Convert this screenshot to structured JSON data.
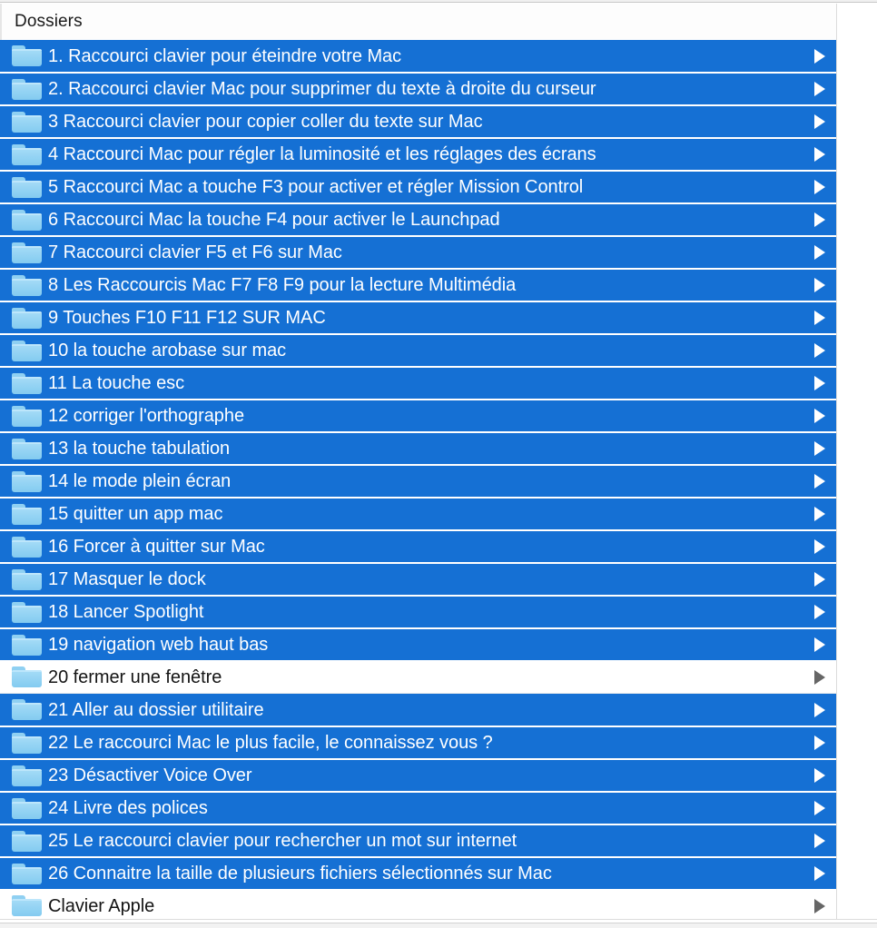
{
  "window": {
    "title": "Dossiers"
  },
  "header": {
    "column_title": "Dossiers"
  },
  "colors": {
    "selection_blue": "#1570d4",
    "folder_icon_blue": "#8ed2f4",
    "selected_text": "#ffffff",
    "unselected_text": "#141414",
    "disclosure_selected": "#ffffff",
    "disclosure_unselected": "#666666",
    "row_background": "#ffffff",
    "divider": "#dcdcdc"
  },
  "icons": {
    "folder": "folder-icon",
    "disclosure": "disclosure-triangle-icon"
  },
  "list": {
    "rows": [
      {
        "label": "1. Raccourci clavier pour éteindre votre Mac",
        "selected": true,
        "icon": "folder-icon",
        "disclosure": true
      },
      {
        "label": "2. Raccourci clavier Mac pour supprimer du texte à droite du curseur",
        "selected": true,
        "icon": "folder-icon",
        "disclosure": true
      },
      {
        "label": "3 Raccourci clavier pour copier coller du texte sur Mac",
        "selected": true,
        "icon": "folder-icon",
        "disclosure": true
      },
      {
        "label": "4 Raccourci Mac pour régler la luminosité et les réglages des écrans",
        "selected": true,
        "icon": "folder-icon",
        "disclosure": true
      },
      {
        "label": "5 Raccourci Mac a touche F3 pour activer et régler Mission Control",
        "selected": true,
        "icon": "folder-icon",
        "disclosure": true
      },
      {
        "label": "6 Raccourci Mac la touche F4 pour activer le Launchpad",
        "selected": true,
        "icon": "folder-icon",
        "disclosure": true
      },
      {
        "label": "7 Raccourci clavier F5 et F6 sur Mac",
        "selected": true,
        "icon": "folder-icon",
        "disclosure": true
      },
      {
        "label": "8 Les Raccourcis Mac F7 F8 F9 pour la lecture Multimédia",
        "selected": true,
        "icon": "folder-icon",
        "disclosure": true
      },
      {
        "label": "9 Touches F10 F11 F12 SUR MAC",
        "selected": true,
        "icon": "folder-icon",
        "disclosure": true
      },
      {
        "label": "10 la touche arobase sur mac",
        "selected": true,
        "icon": "folder-icon",
        "disclosure": true
      },
      {
        "label": "11 La touche esc",
        "selected": true,
        "icon": "folder-icon",
        "disclosure": true
      },
      {
        "label": "12 corriger l'orthographe",
        "selected": true,
        "icon": "folder-icon",
        "disclosure": true
      },
      {
        "label": "13 la touche tabulation",
        "selected": true,
        "icon": "folder-icon",
        "disclosure": true
      },
      {
        "label": "14 le mode plein écran",
        "selected": true,
        "icon": "folder-icon",
        "disclosure": true
      },
      {
        "label": "15 quitter un app mac",
        "selected": true,
        "icon": "folder-icon",
        "disclosure": true
      },
      {
        "label": "16 Forcer à quitter sur Mac",
        "selected": true,
        "icon": "folder-icon",
        "disclosure": true
      },
      {
        "label": "17 Masquer le dock",
        "selected": true,
        "icon": "folder-icon",
        "disclosure": true
      },
      {
        "label": "18 Lancer Spotlight",
        "selected": true,
        "icon": "folder-icon",
        "disclosure": true
      },
      {
        "label": "19 navigation web haut bas",
        "selected": true,
        "icon": "folder-icon",
        "disclosure": true
      },
      {
        "label": "20 fermer une fenêtre",
        "selected": false,
        "icon": "folder-icon",
        "disclosure": true
      },
      {
        "label": "21 Aller au dossier utilitaire",
        "selected": true,
        "icon": "folder-icon",
        "disclosure": true
      },
      {
        "label": "22 Le raccourci Mac le plus facile, le connaissez vous ?",
        "selected": true,
        "icon": "folder-icon",
        "disclosure": true
      },
      {
        "label": "23 Désactiver Voice Over",
        "selected": true,
        "icon": "folder-icon",
        "disclosure": true
      },
      {
        "label": "24 Livre des polices",
        "selected": true,
        "icon": "folder-icon",
        "disclosure": true
      },
      {
        "label": "25 Le raccourci clavier pour rechercher un mot sur internet",
        "selected": true,
        "icon": "folder-icon",
        "disclosure": true
      },
      {
        "label": "26 Connaitre la taille de plusieurs fichiers sélectionnés sur Mac",
        "selected": true,
        "icon": "folder-icon",
        "disclosure": true
      },
      {
        "label": "Clavier Apple",
        "selected": false,
        "icon": "folder-icon",
        "disclosure": true
      }
    ]
  }
}
